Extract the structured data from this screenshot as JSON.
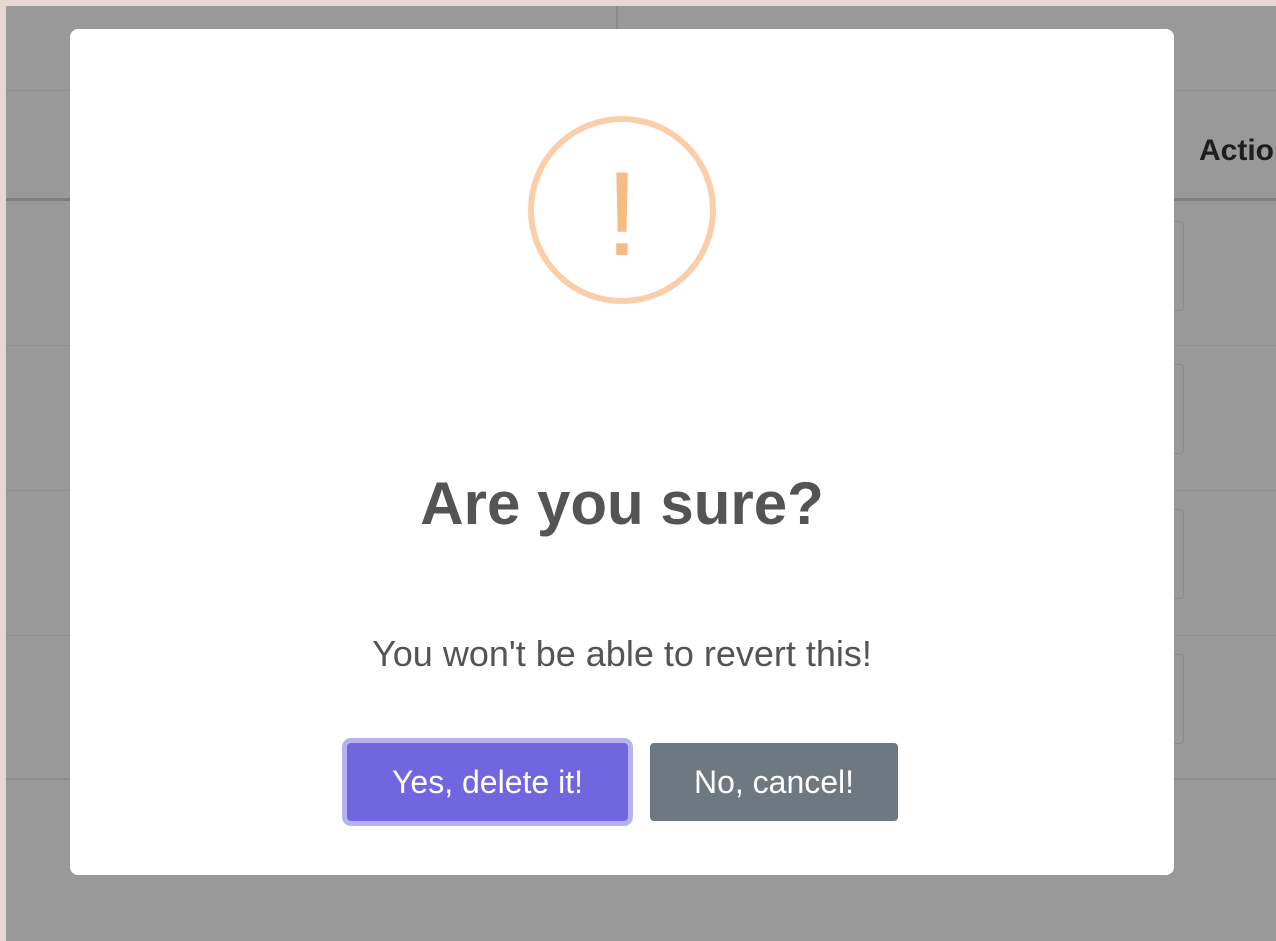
{
  "background": {
    "table_header_partial": "Actio"
  },
  "dialog": {
    "icon": "exclamation-warning-icon",
    "icon_glyph": "!",
    "icon_color": "#f8bb86",
    "icon_ring_color": "#facea8",
    "title": "Are you sure?",
    "text": "You won't be able to revert this!",
    "confirm_label": "Yes, delete it!",
    "cancel_label": "No, cancel!",
    "confirm_color": "#7066e0",
    "cancel_color": "#6e7881"
  }
}
